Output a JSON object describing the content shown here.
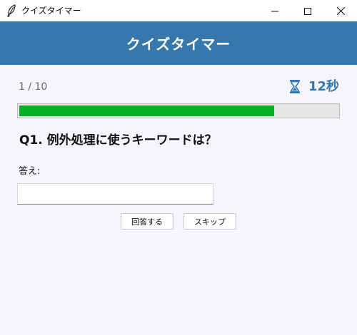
{
  "window": {
    "title": "クイズタイマー"
  },
  "header": {
    "title": "クイズタイマー"
  },
  "status": {
    "progress_text": "1 / 10",
    "timer_text": "12秒",
    "time_remaining_fraction": 0.8
  },
  "question": {
    "text": "Q1. 例外処理に使うキーワードは？"
  },
  "answer": {
    "label": "答え:",
    "value": ""
  },
  "buttons": {
    "submit_label": "回答する",
    "skip_label": "スキップ"
  },
  "colors": {
    "header_bg": "#3677ac",
    "timer_text": "#3677ac",
    "progress_fill": "#06b025",
    "page_bg": "#f4f6fa"
  },
  "icons": {
    "app": "feather-icon",
    "timer": "hourglass-icon"
  }
}
